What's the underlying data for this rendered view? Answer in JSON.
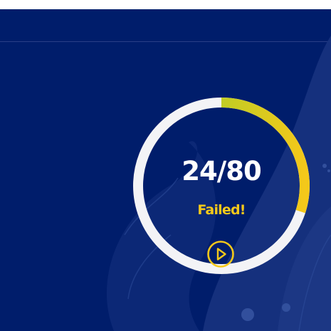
{
  "result": {
    "score": "24/80",
    "score_value": 24,
    "score_max": 80,
    "status": "Failed!"
  },
  "colors": {
    "background": "#001d6b",
    "ring_track": "#f3f3f6",
    "ring_progress_start": "#8dd12e",
    "ring_progress_end": "#f4c81a",
    "status": "#f4c81a"
  },
  "icons": {
    "play": "play-circle-icon"
  }
}
